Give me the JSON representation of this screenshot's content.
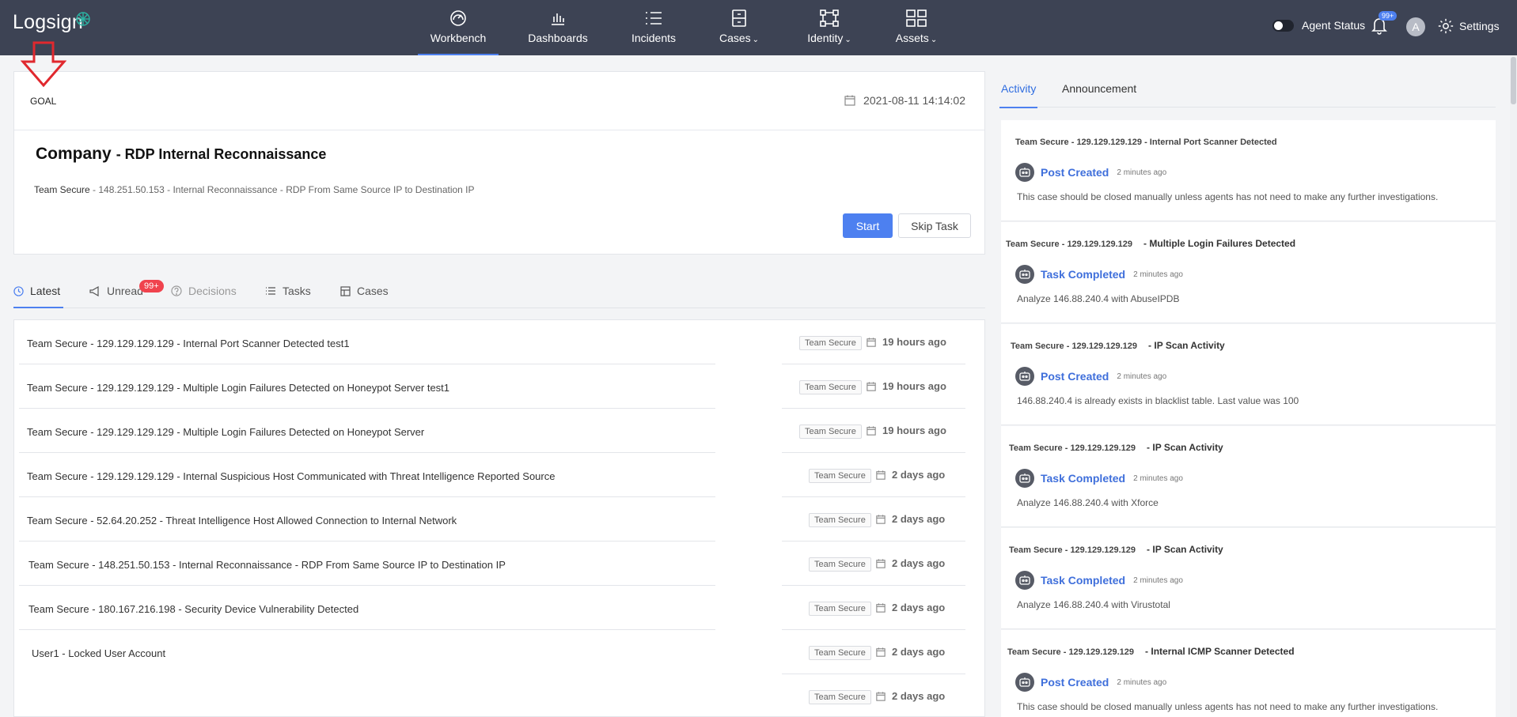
{
  "app": {
    "logo": "Logsign"
  },
  "nav": {
    "items": [
      {
        "label": "Workbench",
        "icon": "gauge-icon",
        "active": true
      },
      {
        "label": "Dashboards",
        "icon": "bar-chart-icon"
      },
      {
        "label": "Incidents",
        "icon": "list-icon"
      },
      {
        "label": "Cases",
        "icon": "cabinet-icon",
        "dropdown": true
      },
      {
        "label": "Identity",
        "icon": "network-icon",
        "dropdown": true
      },
      {
        "label": "Assets",
        "icon": "grid-icon",
        "dropdown": true
      }
    ]
  },
  "header_right": {
    "agent_status_label": "Agent Status",
    "notifications_badge": "99+",
    "avatar_initial": "A",
    "settings_label": "Settings"
  },
  "goal": {
    "label": "GOAL",
    "date": "2021-08-11 14:14:02",
    "company": "Company",
    "title_suffix": "- RDP Internal Reconnaissance",
    "team": "Team Secure",
    "description": " - 148.251.50.153 - Internal Reconnaissance - RDP From Same Source IP to Destination IP",
    "start_label": "Start",
    "skip_label": "Skip Task"
  },
  "feed_tabs": [
    {
      "label": "Latest",
      "icon": "clock-icon",
      "active": true
    },
    {
      "label": "Unread",
      "icon": "megaphone-icon"
    },
    {
      "label": "Decisions",
      "icon": "question-circle-icon",
      "muted": true
    },
    {
      "label": "Tasks",
      "icon": "list-icon"
    },
    {
      "label": "Cases",
      "icon": "calendar-grid-icon"
    }
  ],
  "unread_badge": "99+",
  "feed": [
    {
      "title": "Team Secure - 129.129.129.129 - Internal Port Scanner Detected test1",
      "tag": "Team Secure",
      "time": "19 hours ago"
    },
    {
      "title": "Team Secure - 129.129.129.129 - Multiple Login Failures Detected on Honeypot Server test1",
      "tag": "Team Secure",
      "time": "19 hours ago"
    },
    {
      "title": "Team Secure - 129.129.129.129 - Multiple Login Failures Detected on Honeypot Server",
      "tag": "Team Secure",
      "time": "19 hours ago"
    },
    {
      "title": "Team Secure - 129.129.129.129 - Internal Suspicious Host Communicated with Threat Intelligence Reported Source",
      "tag": "Team Secure",
      "time": "2 days ago"
    },
    {
      "title": "Team Secure - 52.64.20.252 - Threat Intelligence Host Allowed Connection to Internal Network",
      "tag": "Team Secure",
      "time": "2 days ago"
    },
    {
      "title": "Team Secure - 148.251.50.153 - Internal Reconnaissance - RDP From Same Source IP to Destination IP",
      "tag": "Team Secure",
      "time": "2 days ago"
    },
    {
      "title": "Team Secure - 180.167.216.198 - Security Device Vulnerability Detected",
      "tag": "Team Secure",
      "time": "2 days ago"
    },
    {
      "title": "User1 - Locked User Account",
      "tag": "Team Secure",
      "time": "2 days ago"
    },
    {
      "title": "",
      "tag": "Team Secure",
      "time": "2 days ago"
    }
  ],
  "right_tabs": [
    {
      "label": "Activity",
      "active": true
    },
    {
      "label": "Announcement"
    }
  ],
  "activity": [
    {
      "source": "Team Secure - 129.129.129.129 - Internal Port Scanner Detected",
      "subject": "",
      "type": "Post Created",
      "ago": "2 minutes ago",
      "text": "This case should be closed manually unless agents has not need to make any further investigations."
    },
    {
      "source": "Team Secure - 129.129.129.129",
      "subject": "- Multiple Login Failures Detected",
      "type": "Task Completed",
      "ago": "2 minutes ago",
      "text": "Analyze 146.88.240.4 with AbuseIPDB"
    },
    {
      "source": "Team Secure - 129.129.129.129",
      "subject": "- IP Scan Activity",
      "type": "Post Created",
      "ago": "2 minutes ago",
      "text": "146.88.240.4 is already exists in blacklist table. Last value was 100"
    },
    {
      "source": "Team Secure - 129.129.129.129",
      "subject": "- IP Scan Activity",
      "type": "Task Completed",
      "ago": "2 minutes ago",
      "text": "Analyze 146.88.240.4 with Xforce"
    },
    {
      "source": "Team Secure - 129.129.129.129",
      "subject": "- IP Scan Activity",
      "type": "Task Completed",
      "ago": "2 minutes ago",
      "text": "Analyze 146.88.240.4 with Virustotal"
    },
    {
      "source": "Team Secure - 129.129.129.129",
      "subject": "- Internal ICMP Scanner Detected",
      "type": "Post Created",
      "ago": "2 minutes ago",
      "text": "This case should be closed manually unless agents has not need to make any further investigations."
    }
  ],
  "colors": {
    "topbar": "#3d4354",
    "accent": "#4d80f0",
    "badge_red": "#f0434e",
    "annotation": "#e0282e"
  }
}
